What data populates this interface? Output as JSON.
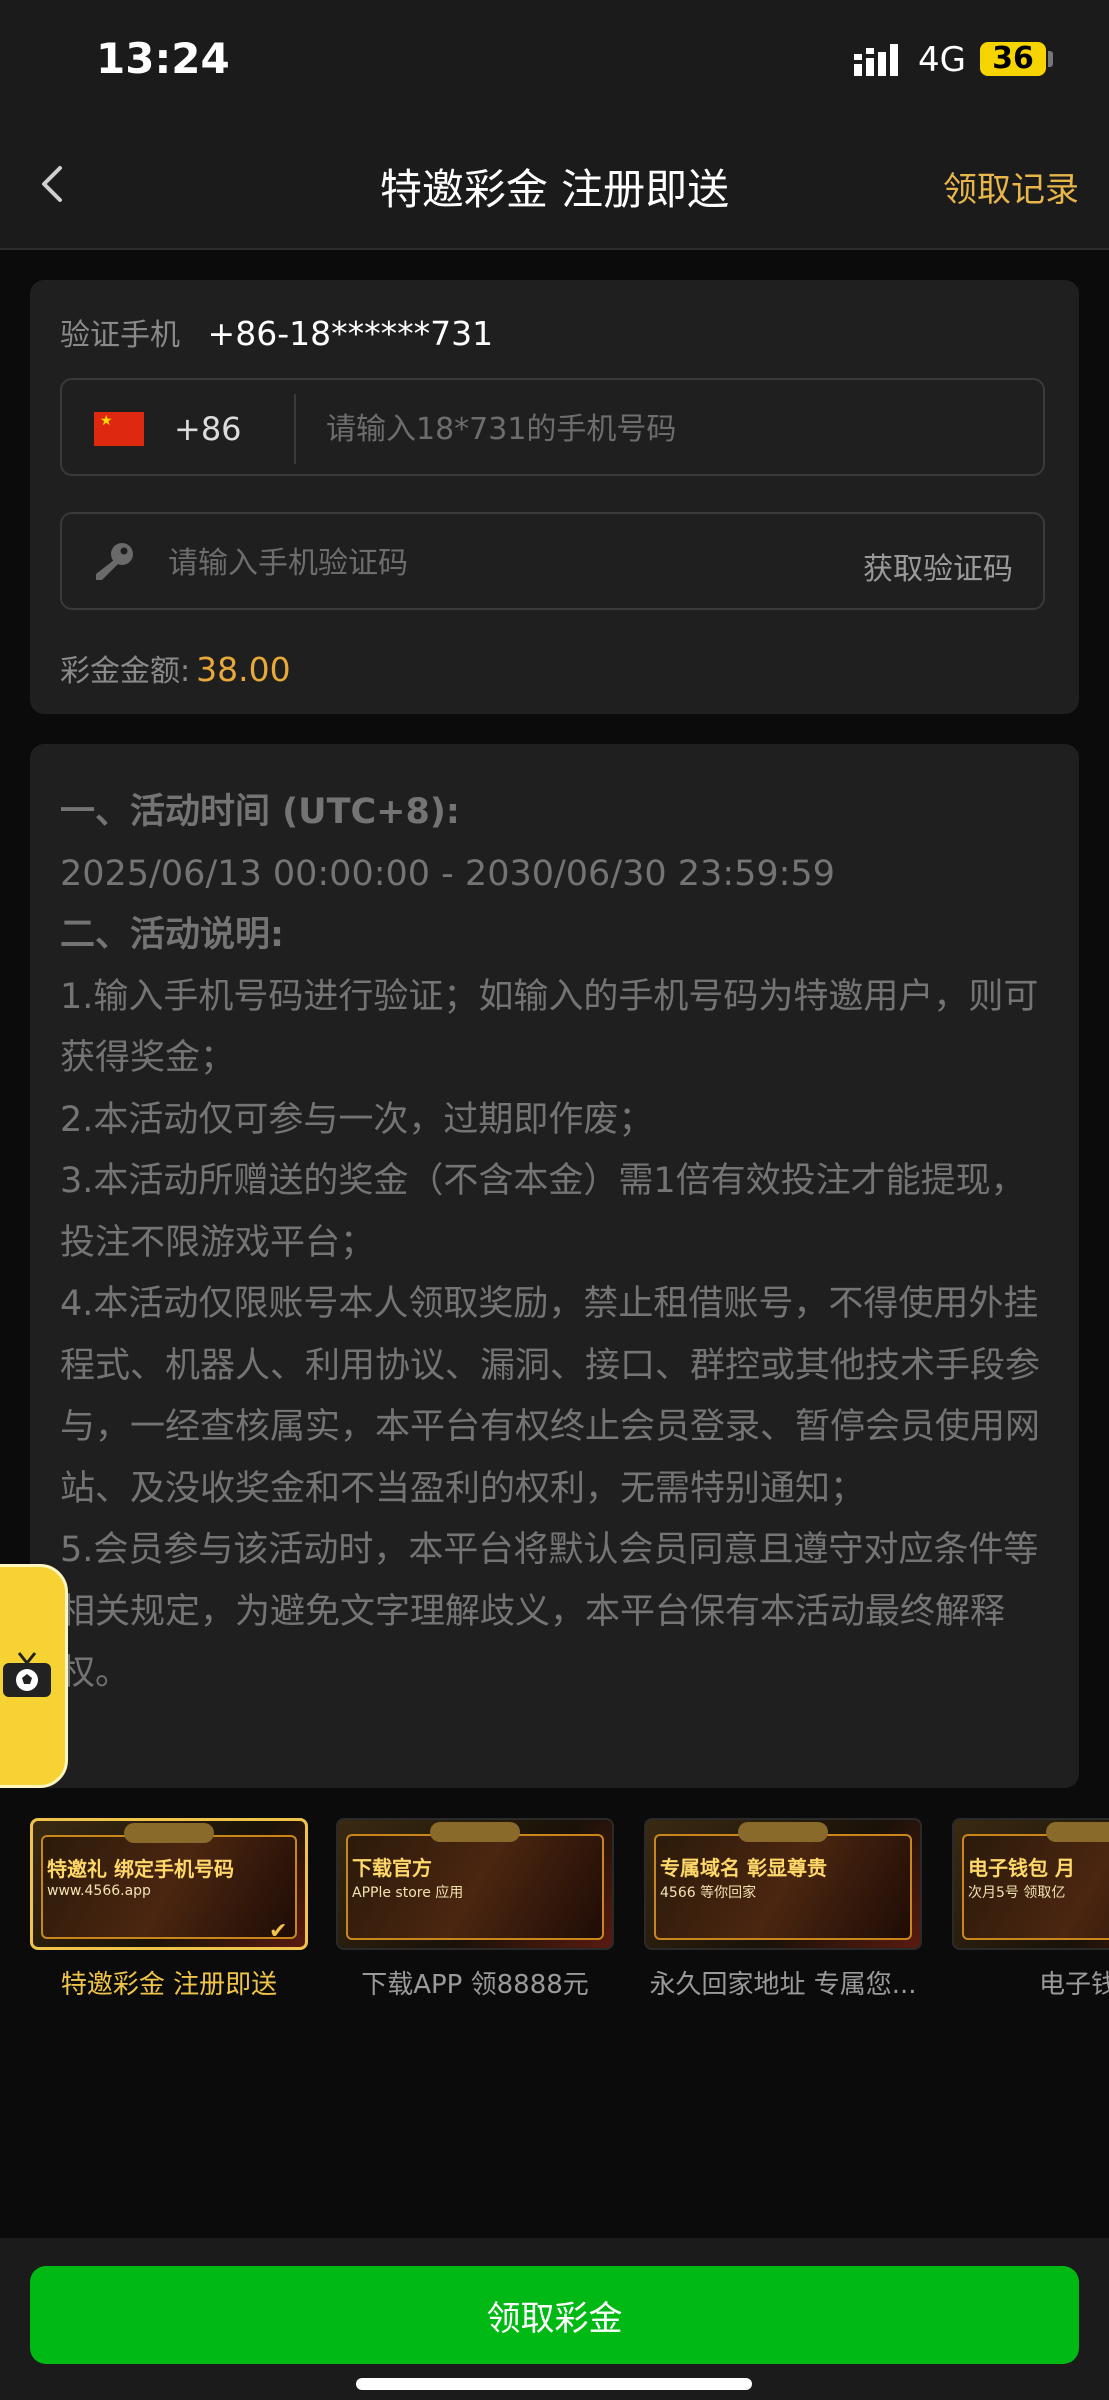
{
  "status_bar": {
    "time": "13:24",
    "network": "4G",
    "battery": "36"
  },
  "header": {
    "title": "特邀彩金 注册即送",
    "record_link": "领取记录"
  },
  "form": {
    "verify_label": "验证手机",
    "verify_value": "+86-18******731",
    "country_code": "+86",
    "phone_placeholder": "请输入18*731的手机号码",
    "code_placeholder": "请输入手机验证码",
    "get_code_label": "获取验证码",
    "amount_label": "彩金金额:",
    "amount_value": "38.00"
  },
  "rules": {
    "section1_title": "一、活动时间 (UTC+8):",
    "time_range": "2025/06/13 00:00:00 - 2030/06/30 23:59:59",
    "section2_title": "二、活动说明:",
    "items": [
      "1.输入手机号码进行验证；如输入的手机号码为特邀用户，则可获得奖金；",
      "2.本活动仅可参与一次，过期即作废；",
      "3.本活动所赠送的奖金（不含本金）需1倍有效投注才能提现，投注不限游戏平台；",
      "4.本活动仅限账号本人领取奖励，禁止租借账号，不得使用外挂程式、机器人、利用协议、漏洞、接口、群控或其他技术手段参与，一经查核属实，本平台有权终止会员登录、暂停会员使用网站、及没收奖金和不当盈利的权利，无需特别通知；",
      "5.会员参与该活动时，本平台将默认会员同意且遵守对应条件等相关规定，为避免文字理解歧义，本平台保有本活动最终解释权。"
    ]
  },
  "banners": [
    {
      "caption": "特邀彩金 注册即送",
      "headline": "特邀礼 绑定手机号码",
      "sub": "www.4566.app",
      "active": true
    },
    {
      "caption": "下载APP 领8888元",
      "headline": "下载官方",
      "sub": "APPle store 应用",
      "active": false
    },
    {
      "caption": "永久回家地址 专属您...",
      "headline": "专属域名 彰显尊贵",
      "sub": "4566 等你回家",
      "active": false
    },
    {
      "caption": "电子钱包",
      "headline": "电子钱包 月",
      "sub": "次月5号 领取亿",
      "active": false
    }
  ],
  "bottom": {
    "claim_button": "领取彩金"
  },
  "colors": {
    "accent_gold": "#e7b54a",
    "amount": "#e7a93a",
    "claim_green": "#00b914"
  },
  "icons": [
    "back-arrow-icon",
    "china-flag-icon",
    "key-icon",
    "tv-football-icon",
    "check-icon"
  ]
}
